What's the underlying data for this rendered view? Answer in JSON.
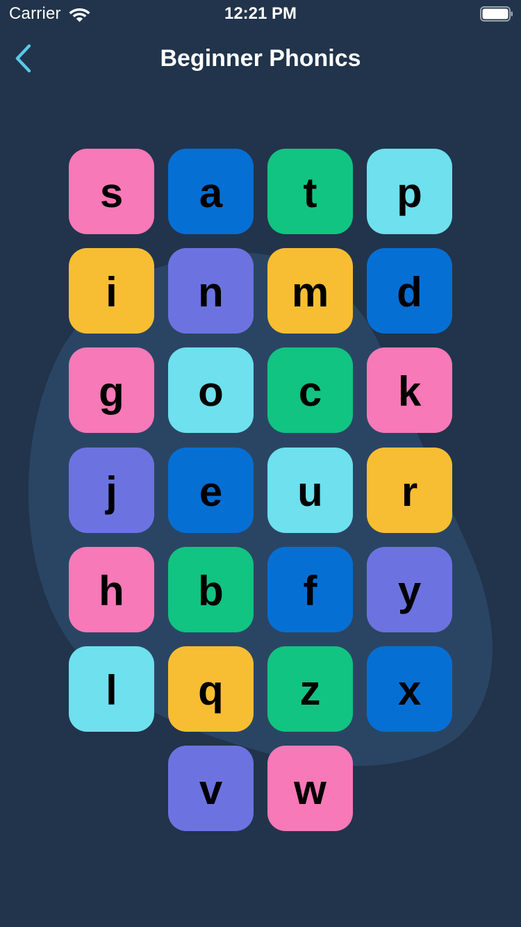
{
  "status_bar": {
    "carrier": "Carrier",
    "time": "12:21 PM",
    "wifi_icon": "wifi-icon",
    "battery_icon": "battery-icon"
  },
  "nav": {
    "title": "Beginner Phonics",
    "back_icon": "chevron-left-icon",
    "back_color": "#5AC8E6"
  },
  "colors": {
    "background": "#21344B",
    "blob": "#2A4563",
    "pink": "#F779B7",
    "blue": "#066FD4",
    "green": "#11C482",
    "cyan": "#6EE0EE",
    "yellow": "#F7BE33",
    "purple": "#6C73E0"
  },
  "letters": [
    {
      "letter": "s",
      "color": "#F779B7"
    },
    {
      "letter": "a",
      "color": "#066FD4"
    },
    {
      "letter": "t",
      "color": "#11C482"
    },
    {
      "letter": "p",
      "color": "#6EE0EE"
    },
    {
      "letter": "i",
      "color": "#F7BE33"
    },
    {
      "letter": "n",
      "color": "#6C73E0"
    },
    {
      "letter": "m",
      "color": "#F7BE33"
    },
    {
      "letter": "d",
      "color": "#066FD4"
    },
    {
      "letter": "g",
      "color": "#F779B7"
    },
    {
      "letter": "o",
      "color": "#6EE0EE"
    },
    {
      "letter": "c",
      "color": "#11C482"
    },
    {
      "letter": "k",
      "color": "#F779B7"
    },
    {
      "letter": "j",
      "color": "#6C73E0"
    },
    {
      "letter": "e",
      "color": "#066FD4"
    },
    {
      "letter": "u",
      "color": "#6EE0EE"
    },
    {
      "letter": "r",
      "color": "#F7BE33"
    },
    {
      "letter": "h",
      "color": "#F779B7"
    },
    {
      "letter": "b",
      "color": "#11C482"
    },
    {
      "letter": "f",
      "color": "#066FD4"
    },
    {
      "letter": "y",
      "color": "#6C73E0"
    },
    {
      "letter": "l",
      "color": "#6EE0EE"
    },
    {
      "letter": "q",
      "color": "#F7BE33"
    },
    {
      "letter": "z",
      "color": "#11C482"
    },
    {
      "letter": "x",
      "color": "#066FD4"
    },
    {
      "letter": "v",
      "color": "#6C73E0"
    },
    {
      "letter": "w",
      "color": "#F779B7"
    }
  ]
}
